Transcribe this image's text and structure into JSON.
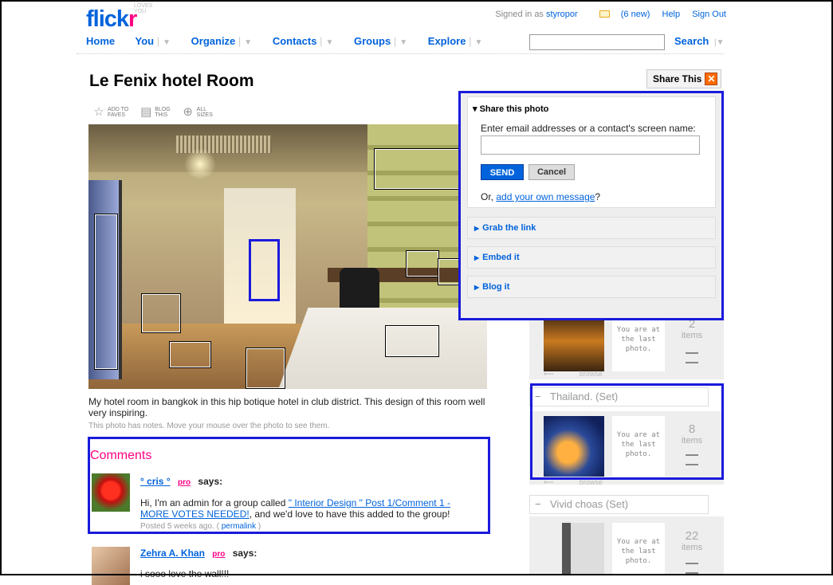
{
  "header": {
    "logo_main": "flick",
    "logo_r": "r",
    "logo_tagline": "LOVES YOU",
    "signed_in_label": "Signed in as",
    "username": "styropor",
    "mail": "(6 new)",
    "help": "Help",
    "sign_out": "Sign Out",
    "nav": [
      {
        "label": "Home"
      },
      {
        "label": "You"
      },
      {
        "label": "Organize"
      },
      {
        "label": "Contacts"
      },
      {
        "label": "Groups"
      },
      {
        "label": "Explore"
      }
    ],
    "search_label": "Search",
    "search_value": ""
  },
  "photo": {
    "title": "Le Fenix hotel Room",
    "tools": [
      {
        "icon": "star-icon",
        "label1": "ADD TO",
        "label2": "FAVES"
      },
      {
        "icon": "blog-icon",
        "label1": "BLOG",
        "label2": "THIS"
      },
      {
        "icon": "magnifier-icon",
        "label1": "ALL",
        "label2": "SIZES"
      }
    ],
    "description": "My hotel room in bangkok in this hip botique hotel in club district. This design of this room well very inspiring.",
    "notes_hint": "This photo has notes. Move your mouse over the photo to see them."
  },
  "comments": {
    "title": "Comments",
    "items": [
      {
        "user": "° cris °",
        "pro": "pro",
        "says": "says:",
        "text_before": "Hi, I'm an admin for a group called ",
        "link": "\" Interior Design \" Post 1/Comment 1 - MORE VOTES NEEDED!",
        "text_after": ", and we'd love to have this added to the group!",
        "posted": "Posted 5 weeks ago. (",
        "permalink": "permalink",
        "posted_end": ")"
      },
      {
        "user": "Zehra A. Khan",
        "pro": "pro",
        "says": "says:",
        "text": "i sooo love the wall!!!"
      }
    ]
  },
  "share": {
    "button": "Share This",
    "heading": "Share this photo",
    "email_label": "Enter email addresses or a contact's screen name:",
    "email_value": "",
    "send": "SEND",
    "cancel": "Cancel",
    "or_prefix": "Or, ",
    "or_link": "add your own message",
    "or_suffix": "?",
    "sections": [
      "Grab the link",
      "Embed it",
      "Blog it"
    ]
  },
  "context": {
    "stream": {
      "last": "You are at the last photo.",
      "count": "2",
      "count_label": "items",
      "browse": "browse"
    },
    "sets": [
      {
        "name": "Thailand. (Set)",
        "last": "You are at the last photo.",
        "count": "8",
        "count_label": "items",
        "browse": "browse"
      },
      {
        "name": "Vivid choas (Set)",
        "last": "You are at the last photo.",
        "count": "22",
        "count_label": "items"
      }
    ]
  },
  "colors": {
    "brand_blue": "#0063dc",
    "brand_pink": "#ff0084",
    "highlight_box": "#1a1adc"
  }
}
